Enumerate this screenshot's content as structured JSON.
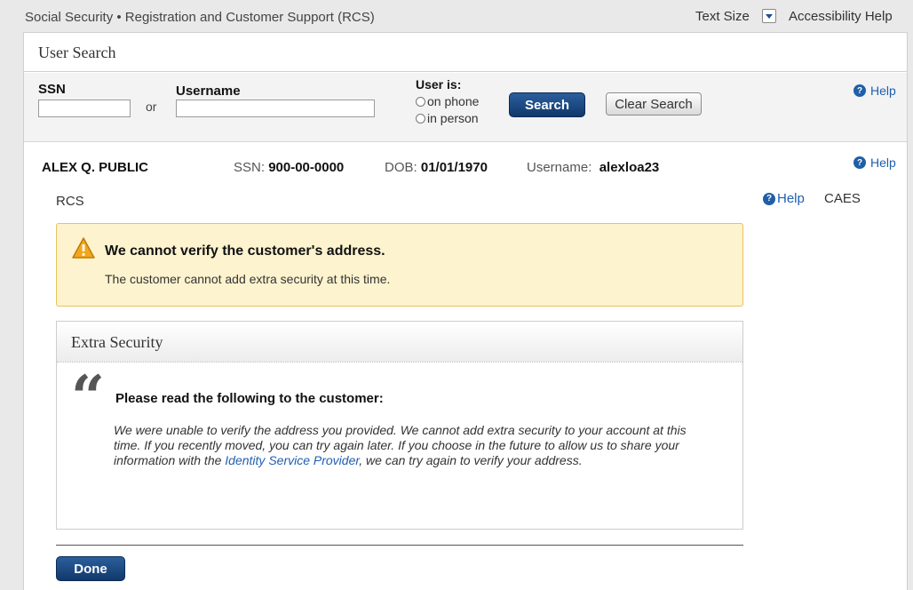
{
  "header": {
    "app_title": "Social Security • Registration and Customer Support (RCS)",
    "text_size_label": "Text Size",
    "accessibility_label": "Accessibility Help"
  },
  "search": {
    "title": "User Search",
    "ssn_label": "SSN",
    "ssn_value": "",
    "or_label": "or",
    "username_label": "Username",
    "username_value": "",
    "user_is_label": "User is:",
    "radio_phone": "on phone",
    "radio_person": "in person",
    "search_button": "Search",
    "clear_button": "Clear Search",
    "help_label": "Help"
  },
  "customer": {
    "name": "ALEX Q. PUBLIC",
    "ssn_label": "SSN:",
    "ssn": "900-00-0000",
    "dob_label": "DOB:",
    "dob": "01/01/1970",
    "username_label": "Username:",
    "username": "alexloa23",
    "help_label": "Help"
  },
  "section": {
    "rcs_label": "RCS",
    "help_label": "Help",
    "caes_label": "CAES"
  },
  "alert": {
    "title": "We cannot verify the customer's address.",
    "body": "The customer cannot add extra security at this time."
  },
  "card": {
    "title": "Extra Security",
    "quote_glyph": "“",
    "read_label": "Please read the following to the customer:",
    "script_part1": "We were unable to verify the address you provided. We cannot add extra security to your account at this time. If you recently moved, you can try again later. If you choose in the future to allow us to share your information with the ",
    "script_link": "Identity Service Provider",
    "script_part2": ", we can try again to verify your address."
  },
  "footer": {
    "done_button": "Done"
  },
  "icons": {
    "help": "question-circle-icon",
    "warning": "warning-triangle-icon",
    "dropdown": "chevron-down-icon"
  },
  "colors": {
    "primary_button": "#11386b",
    "link": "#1f5fb0",
    "alert_bg": "#fdf3cf",
    "alert_border": "#e9c25d"
  }
}
